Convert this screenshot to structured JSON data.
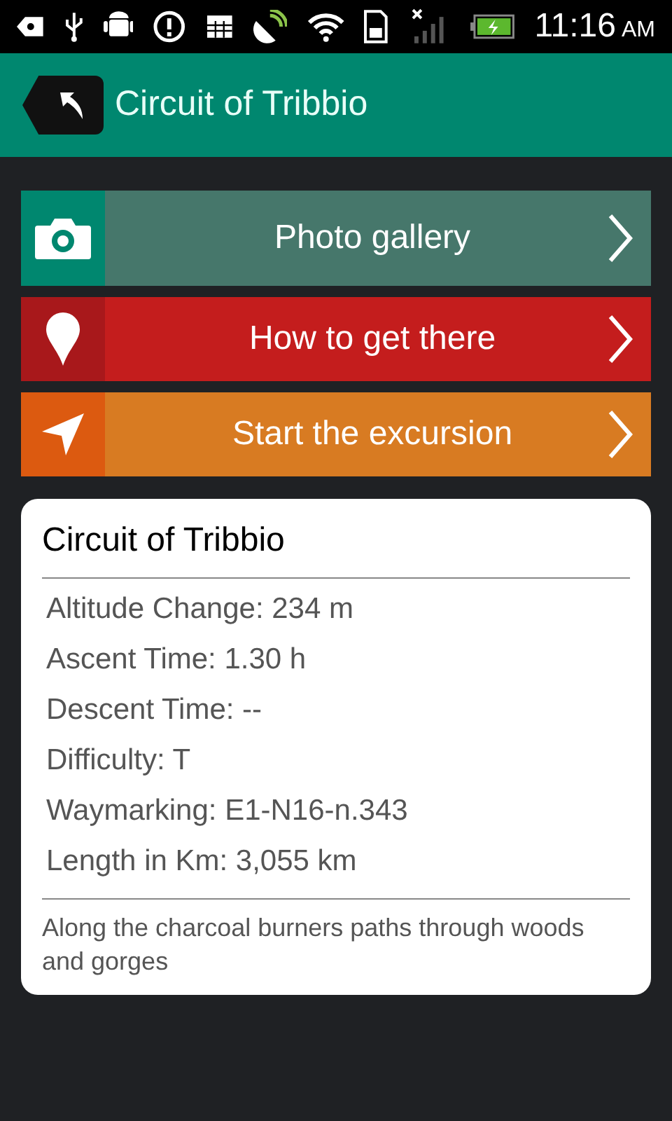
{
  "status_bar": {
    "time": "11:16",
    "ampm": "AM"
  },
  "header": {
    "title": "Circuit of Tribbio"
  },
  "actions": [
    {
      "kind": "camera",
      "label": "Photo gallery",
      "color": "#46776b"
    },
    {
      "kind": "pin",
      "label": "How to get there",
      "color": "#c41d1d"
    },
    {
      "kind": "navigate",
      "label": "Start the excursion",
      "color": "#d87b22"
    }
  ],
  "card": {
    "title": "Circuit of Tribbio",
    "facts": [
      "Altitude Change: 234 m",
      "Ascent Time: 1.30 h",
      "Descent Time: --",
      "Difficulty: T",
      "Waymarking: E1-N16-n.343",
      "Length in Km: 3,055 km"
    ],
    "description": "Along the charcoal burners paths through woods and gorges"
  }
}
